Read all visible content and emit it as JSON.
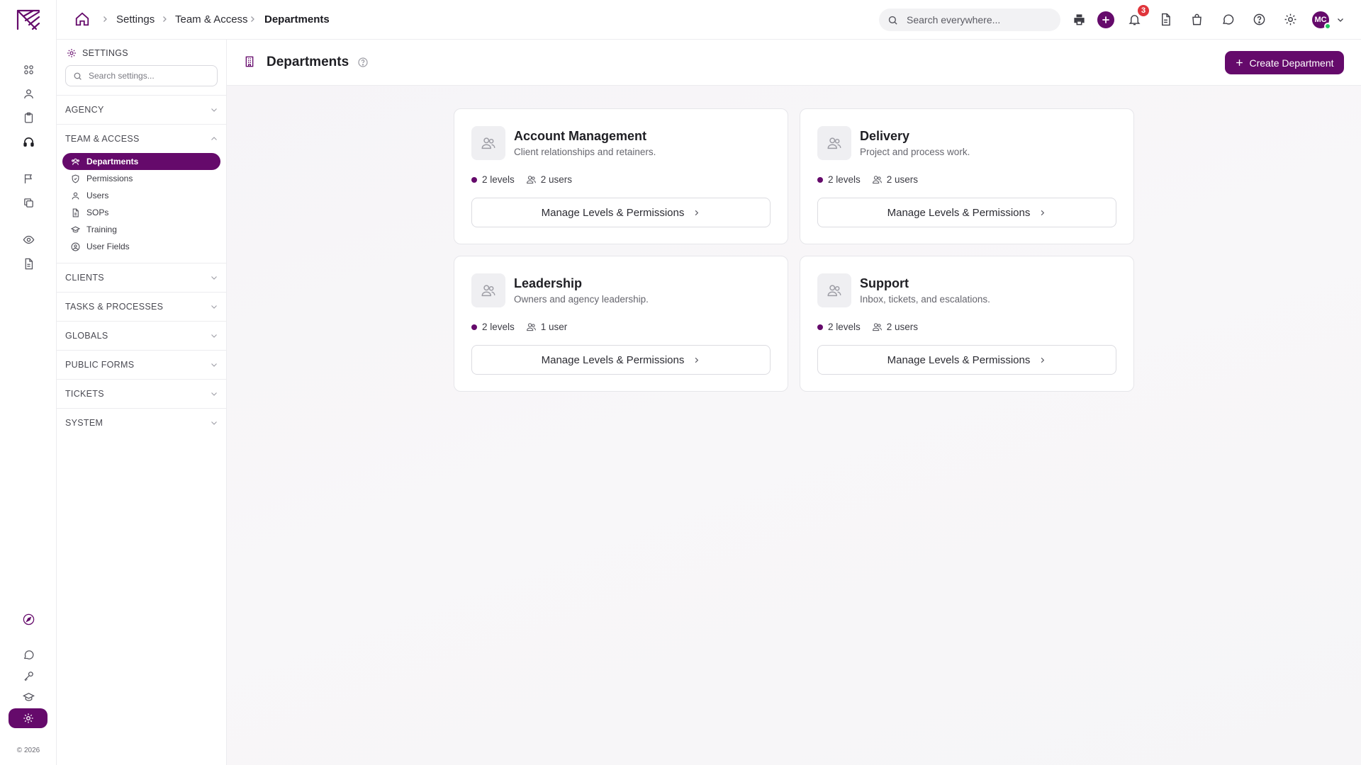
{
  "app": {
    "brand_color": "#650a6b",
    "accent_green": "#22c55e",
    "badge_red": "#e0353b"
  },
  "rail": {
    "top_icons": [
      "grid-icon",
      "person-icon",
      "clipboard-icon",
      "headset-icon",
      "flag-icon",
      "copy-icon",
      "eye-icon",
      "file-icon"
    ],
    "bottom_icons": [
      "rocket-icon",
      "chat-icon",
      "key-icon",
      "graduation-cap-icon",
      "gear-icon"
    ],
    "copyright": "© 2026"
  },
  "topbar": {
    "breadcrumb": [
      "Settings",
      "Team & Access",
      "Departments"
    ],
    "search_placeholder": "Search everywhere...",
    "notification_count": "3",
    "avatar_initials": "MC",
    "icons": [
      "print-icon",
      "add-icon",
      "bell-icon",
      "document-icon",
      "bag-icon",
      "chat-icon",
      "help-icon",
      "gear-icon"
    ]
  },
  "sidebar": {
    "title": "SETTINGS",
    "search_placeholder": "Search settings...",
    "sections": [
      {
        "label": "AGENCY",
        "expanded": false
      },
      {
        "label": "TEAM & ACCESS",
        "expanded": true
      },
      {
        "label": "CLIENTS",
        "expanded": false
      },
      {
        "label": "TASKS & PROCESSES",
        "expanded": false
      },
      {
        "label": "GLOBALS",
        "expanded": false
      },
      {
        "label": "PUBLIC FORMS",
        "expanded": false
      },
      {
        "label": "TICKETS",
        "expanded": false
      },
      {
        "label": "SYSTEM",
        "expanded": false
      }
    ],
    "team_items": [
      {
        "label": "Departments",
        "icon": "users-icon",
        "active": true
      },
      {
        "label": "Permissions",
        "icon": "shield-icon",
        "active": false
      },
      {
        "label": "Users",
        "icon": "user-icon",
        "active": false
      },
      {
        "label": "SOPs",
        "icon": "file-icon",
        "active": false
      },
      {
        "label": "Training",
        "icon": "graduation-cap-icon",
        "active": false
      },
      {
        "label": "User Fields",
        "icon": "user-circle-icon",
        "active": false
      }
    ]
  },
  "page": {
    "title": "Departments",
    "create_button": "Create Department"
  },
  "departments": [
    {
      "name": "Account Management",
      "description": "Client relationships and retainers.",
      "levels": "2 levels",
      "users": "2 users",
      "button": "Manage Levels & Permissions"
    },
    {
      "name": "Delivery",
      "description": "Project and process work.",
      "levels": "2 levels",
      "users": "2 users",
      "button": "Manage Levels & Permissions"
    },
    {
      "name": "Leadership",
      "description": "Owners and agency leadership.",
      "levels": "2 levels",
      "users": "1 user",
      "button": "Manage Levels & Permissions"
    },
    {
      "name": "Support",
      "description": "Inbox, tickets, and escalations.",
      "levels": "2 levels",
      "users": "2 users",
      "button": "Manage Levels & Permissions"
    }
  ]
}
